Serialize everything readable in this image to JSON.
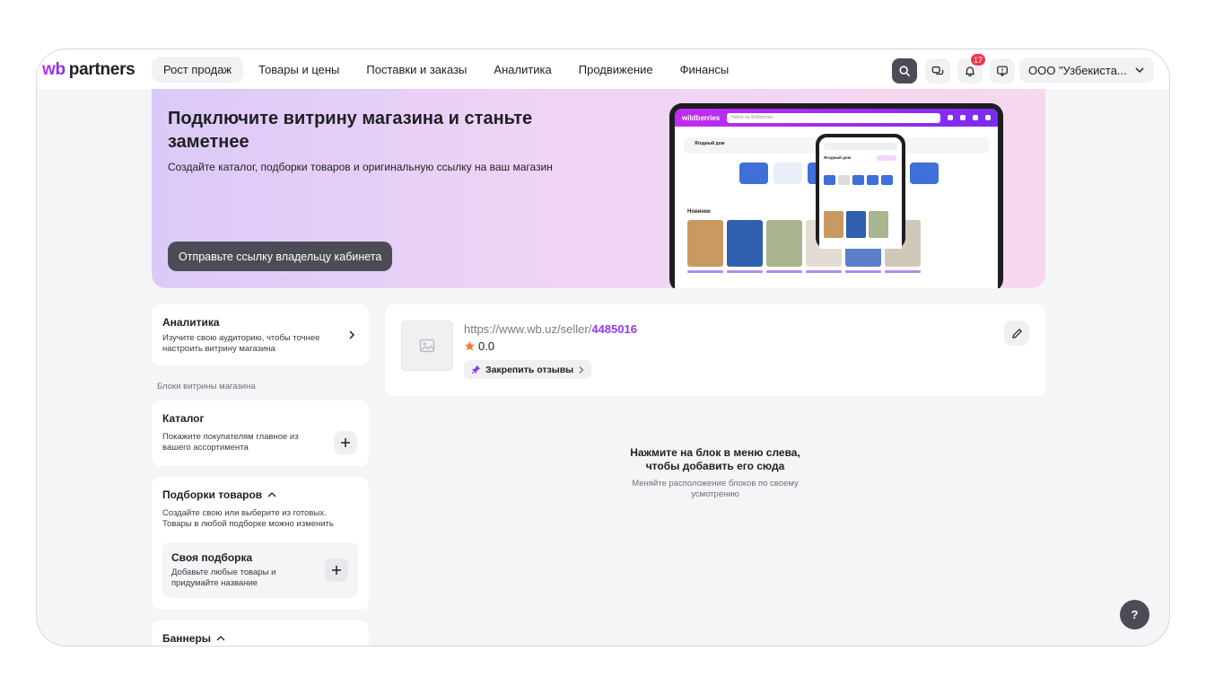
{
  "header": {
    "logo_wb": "wb",
    "logo_partners": "partners",
    "nav": [
      {
        "label": "Рост продаж",
        "active": true
      },
      {
        "label": "Товары и цены"
      },
      {
        "label": "Поставки и заказы"
      },
      {
        "label": "Аналитика"
      },
      {
        "label": "Продвижение"
      },
      {
        "label": "Финансы"
      }
    ],
    "notifications_count": "17",
    "account": "ООО \"Узбекиста..."
  },
  "banner": {
    "title": "Подключите витрину магазина и станьте заметнее",
    "subtitle": "Создайте каталог, подборки товаров и оригинальную ссылку на ваш магазин",
    "button": "Отправьте ссылку владельцу кабинета",
    "mock_logo": "wildberries",
    "mock_search": "Найти на Wildberries",
    "mock_shop": "Ягодный дом",
    "mock_new": "Новинки"
  },
  "left": {
    "analytics": {
      "title": "Аналитика",
      "text": "Изучите свою аудиторию, чтобы точнее настроить витрину магазина"
    },
    "section_label": "Блоки витрины магазина",
    "catalog": {
      "title": "Каталог",
      "text": "Покажите покупателям главное из вашего ассортимента"
    },
    "collections": {
      "title": "Подборки товаров",
      "text": "Создайте свою или выберите из готовых. Товары в любой подборке можно изменить"
    },
    "own_collection": {
      "title": "Своя подборка",
      "text": "Добавьте любые товары и придумайте название"
    },
    "banners": {
      "title": "Баннеры"
    }
  },
  "shop": {
    "url_prefix": "https://www.wb.uz/seller/",
    "seller_id": "4485016",
    "rating": "0.0",
    "pin_reviews": "Закрепить отзывы"
  },
  "empty": {
    "title": "Нажмите на блок в меню слева, чтобы добавить его сюда",
    "subtitle": "Меняйте расположение блоков по своему усмотрению"
  },
  "help": "?",
  "colors": {
    "accent": "#8b3df0",
    "dark_button": "#4c4c57",
    "badge": "#f0374d",
    "star": "#f47b3a"
  }
}
